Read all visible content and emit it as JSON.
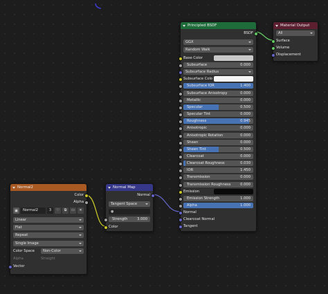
{
  "colors": {
    "bsdf_header": "#1e6c3a",
    "output_header": "#5c1f30",
    "normal_map_header": "#37378a",
    "image_header": "#a85a22"
  },
  "principled": {
    "title": "Principled BSDF",
    "output_label": "BSDF",
    "distribution": "GGX",
    "subsurface_method": "Random Walk",
    "base_color_label": "Base Color",
    "inputs": [
      {
        "label": "Subsurface",
        "value": "0.000",
        "fraction": 0
      },
      {
        "label": "Subsurface Radius",
        "dropdown": true
      },
      {
        "label": "Subsurface Colo",
        "swatch": true
      },
      {
        "label": "Subsurface IOR",
        "value": "1.400",
        "fraction": 1
      },
      {
        "label": "Subsurface Anisotropy",
        "value": "0.000",
        "fraction": 0
      },
      {
        "label": "Metallic",
        "value": "0.000",
        "fraction": 0
      },
      {
        "label": "Specular",
        "value": "0.500",
        "fraction": 0.5
      },
      {
        "label": "Specular Tint",
        "value": "0.000",
        "fraction": 0
      },
      {
        "label": "Roughness",
        "value": "0.945",
        "fraction": 0.945
      },
      {
        "label": "Anisotropic",
        "value": "0.000",
        "fraction": 0
      },
      {
        "label": "Anisotropic Rotation",
        "value": "0.000",
        "fraction": 0
      },
      {
        "label": "Sheen",
        "value": "0.000",
        "fraction": 0
      },
      {
        "label": "Sheen Tint",
        "value": "0.500",
        "fraction": 0.5
      },
      {
        "label": "Clearcoat",
        "value": "0.000",
        "fraction": 0
      },
      {
        "label": "Clearcoat Roughness",
        "value": "0.030",
        "fraction": 0.03
      },
      {
        "label": "IOR",
        "value": "1.450",
        "fraction": 0
      },
      {
        "label": "Transmission",
        "value": "0.000",
        "fraction": 0
      },
      {
        "label": "Transmission Roughness",
        "value": "0.000",
        "fraction": 0
      },
      {
        "label": "Emission",
        "swatch_dark": true
      },
      {
        "label": "Emission Strength",
        "value": "1.000",
        "fraction": 0
      },
      {
        "label": "Alpha",
        "value": "1.000",
        "fraction": 1
      }
    ],
    "normal_label": "Normal",
    "clearcoat_normal_label": "Clearcoat Normal",
    "tangent_label": "Tangent"
  },
  "material_output": {
    "title": "Material Output",
    "target": "All",
    "inputs": [
      "Surface",
      "Volume",
      "Displacement"
    ]
  },
  "normal_map": {
    "title": "Normal Map",
    "output_label": "Normal",
    "space": "Tangent Space",
    "strength_label": "Strength",
    "strength_value": "3.000",
    "color_label": "Color"
  },
  "image_node": {
    "title": "Normal2",
    "out_color": "Color",
    "out_alpha": "Alpha",
    "image_name": "Normal2",
    "users": "3",
    "interpolation": "Linear",
    "projection": "Flat",
    "extension": "Repeat",
    "source": "Single Image",
    "color_space_label": "Color Space",
    "color_space": "Non-Color",
    "alpha_label": "Alpha",
    "alpha_value": "Straight",
    "vector_label": "Vector"
  }
}
